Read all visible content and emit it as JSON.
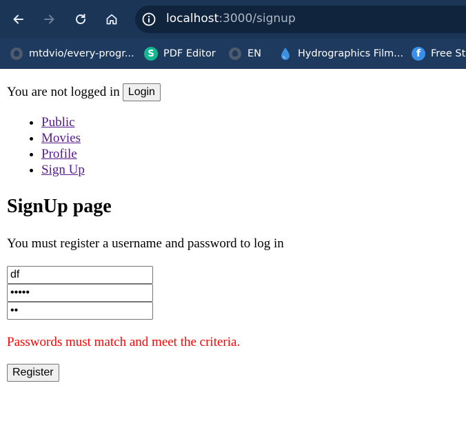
{
  "browser": {
    "url_host": "localhost",
    "url_path": ":3000/signup",
    "bookmarks": [
      {
        "label": "mtdvio/every-progr...",
        "icon": "github-icon"
      },
      {
        "label": "PDF Editor",
        "icon": "s-logo-icon"
      },
      {
        "label": "EN",
        "icon": "github-icon"
      },
      {
        "label": "Hydrographics Film...",
        "icon": "droplet-icon"
      },
      {
        "label": "Free Sto",
        "icon": "f-logo-icon"
      }
    ]
  },
  "auth": {
    "status_text": "You are not logged in",
    "login_label": "Login"
  },
  "nav": {
    "links": [
      "Public",
      "Movies",
      "Profile",
      "Sign Up"
    ]
  },
  "signup": {
    "title": "SignUp page",
    "instructions": "You must register a username and password to log in",
    "username_value": "df",
    "password_value": "•••••",
    "confirm_value": "••",
    "error_text": "Passwords must match and meet the criteria.",
    "register_label": "Register"
  },
  "colors": {
    "error": "#ff0000",
    "visited_link": "#551a8b",
    "toolbar": "#1b3557",
    "bookmarks_bar": "#1e3a5f"
  }
}
